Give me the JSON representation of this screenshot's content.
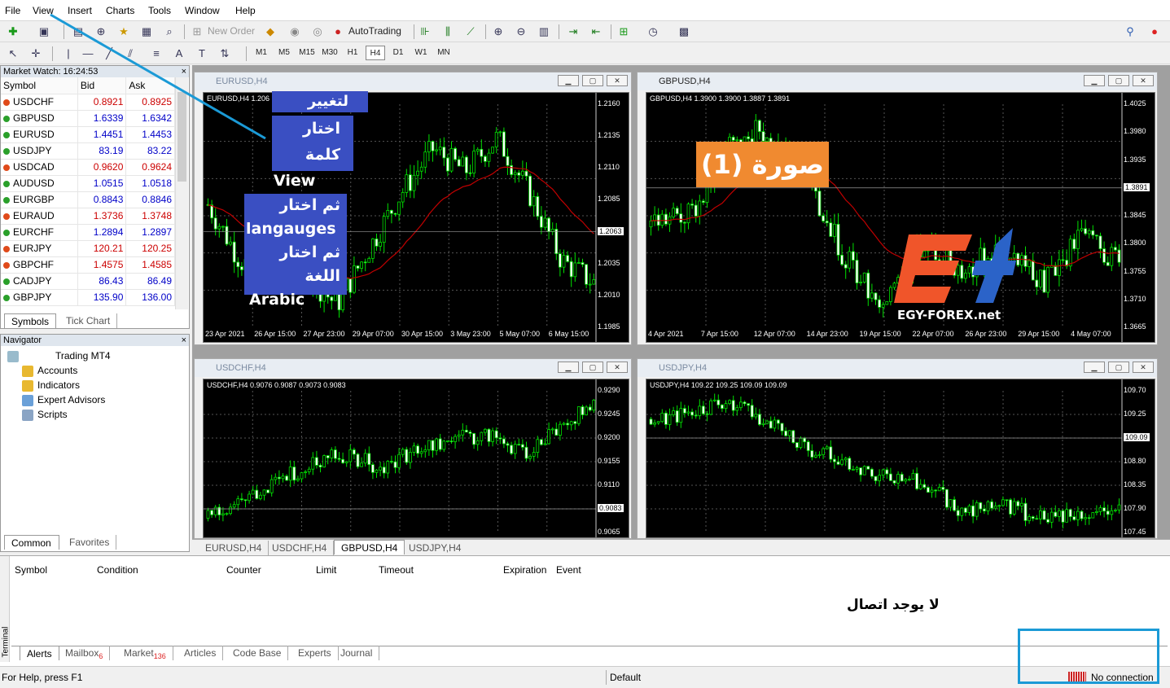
{
  "menu": [
    "File",
    "View",
    "Insert",
    "Charts",
    "Tools",
    "Window",
    "Help"
  ],
  "toolbar": {
    "new_order": "New Order",
    "autotrading": "AutoTrading",
    "timeframes": [
      "M1",
      "M5",
      "M15",
      "M30",
      "H1",
      "H4",
      "D1",
      "W1",
      "MN"
    ]
  },
  "market_watch": {
    "title": "Market Watch: 16:24:53",
    "col_symbol": "Symbol",
    "col_bid": "Bid",
    "col_ask": "Ask",
    "rows": [
      {
        "symbol": "USDCHF",
        "bid": "0.8921",
        "ask": "0.8925",
        "dir": "down"
      },
      {
        "symbol": "GBPUSD",
        "bid": "1.6339",
        "ask": "1.6342",
        "dir": "up"
      },
      {
        "symbol": "EURUSD",
        "bid": "1.4451",
        "ask": "1.4453",
        "dir": "up"
      },
      {
        "symbol": "USDJPY",
        "bid": "83.19",
        "ask": "83.22",
        "dir": "up"
      },
      {
        "symbol": "USDCAD",
        "bid": "0.9620",
        "ask": "0.9624",
        "dir": "down"
      },
      {
        "symbol": "AUDUSD",
        "bid": "1.0515",
        "ask": "1.0518",
        "dir": "up"
      },
      {
        "symbol": "EURGBP",
        "bid": "0.8843",
        "ask": "0.8846",
        "dir": "up"
      },
      {
        "symbol": "EURAUD",
        "bid": "1.3736",
        "ask": "1.3748",
        "dir": "down"
      },
      {
        "symbol": "EURCHF",
        "bid": "1.2894",
        "ask": "1.2897",
        "dir": "up"
      },
      {
        "symbol": "EURJPY",
        "bid": "120.21",
        "ask": "120.25",
        "dir": "down"
      },
      {
        "symbol": "GBPCHF",
        "bid": "1.4575",
        "ask": "1.4585",
        "dir": "down"
      },
      {
        "symbol": "CADJPY",
        "bid": "86.43",
        "ask": "86.49",
        "dir": "up"
      },
      {
        "symbol": "GBPJPY",
        "bid": "135.90",
        "ask": "136.00",
        "dir": "up"
      }
    ],
    "tabs": [
      "Symbols",
      "Tick Chart"
    ]
  },
  "navigator": {
    "title": "Navigator",
    "items": [
      "Trading MT4",
      "Accounts",
      "Indicators",
      "Expert Advisors",
      "Scripts"
    ],
    "tabs": [
      "Common",
      "Favorites"
    ]
  },
  "charts": [
    {
      "title": "EURUSD,H4",
      "info": "EURUSD,H4  1.206",
      "prices": [
        "1.2160",
        "1.2135",
        "1.2110",
        "1.2085",
        "1.2063",
        "1.2035",
        "1.2010",
        "1.1985"
      ],
      "current": "1.2063",
      "dates": [
        "23 Apr 2021",
        "26 Apr 15:00",
        "27 Apr 23:00",
        "29 Apr 07:00",
        "30 Apr 15:00",
        "3 May 23:00",
        "5 May 07:00",
        "6 May 15:00"
      ]
    },
    {
      "title": "GBPUSD,H4",
      "info": "GBPUSD,H4  1.3900 1.3900 1.3887 1.3891",
      "prices": [
        "1.4025",
        "1.3980",
        "1.3935",
        "1.3891",
        "1.3845",
        "1.3800",
        "1.3755",
        "1.3710",
        "1.3665"
      ],
      "current": "1.3891",
      "dates": [
        "4 Apr 2021",
        "7 Apr 15:00",
        "12 Apr 07:00",
        "14 Apr 23:00",
        "19 Apr 15:00",
        "22 Apr 07:00",
        "26 Apr 23:00",
        "29 Apr 15:00",
        "4 May 07:00"
      ]
    },
    {
      "title": "USDCHF,H4",
      "info": "USDCHF,H4  0.9076 0.9087 0.9073 0.9083",
      "prices": [
        "0.9290",
        "0.9245",
        "0.9200",
        "0.9155",
        "0.9110",
        "0.9083",
        "0.9065"
      ],
      "current": "0.9083",
      "dates": []
    },
    {
      "title": "USDJPY,H4",
      "info": "USDJPY,H4  109.22 109.25 109.09 109.09",
      "prices": [
        "109.70",
        "109.25",
        "109.09",
        "108.80",
        "108.35",
        "107.90",
        "107.45"
      ],
      "current": "109.09",
      "dates": []
    }
  ],
  "chart_tabs": [
    "EURUSD,H4",
    "USDCHF,H4",
    "GBPUSD,H4",
    "USDJPY,H4"
  ],
  "annotations": {
    "a1": "لتغيير اللغة",
    "a2a": "اختار كلمة",
    "a2b": "View",
    "a3a": "ثم اختار",
    "a3b": "langauges",
    "a3c": "ثم اختار اللغة",
    "a3d": "Arabic",
    "image_label": "صورة (1)",
    "logo_text": "EGY-FOREX.net",
    "no_conn": "لا يوجد اتصال"
  },
  "terminal": {
    "side_label": "Terminal",
    "columns": [
      "Symbol",
      "Condition",
      "Counter",
      "Limit",
      "Timeout",
      "Expiration",
      "Event"
    ],
    "tabs": [
      {
        "label": "Alerts"
      },
      {
        "label": "Mailbox",
        "badge": "6"
      },
      {
        "label": "Market",
        "badge": "136"
      },
      {
        "label": "Articles"
      },
      {
        "label": "Code Base"
      },
      {
        "label": "Experts"
      },
      {
        "label": "Journal"
      }
    ]
  },
  "status": {
    "help": "For Help, press F1",
    "profile": "Default",
    "connection": "No connection"
  },
  "colors": {
    "candle": "#00e000",
    "ma": "#c00000",
    "annotation_bg": "#3a4fc2",
    "label_bg": "#f08a30",
    "highlight": "#1b9ad6"
  }
}
